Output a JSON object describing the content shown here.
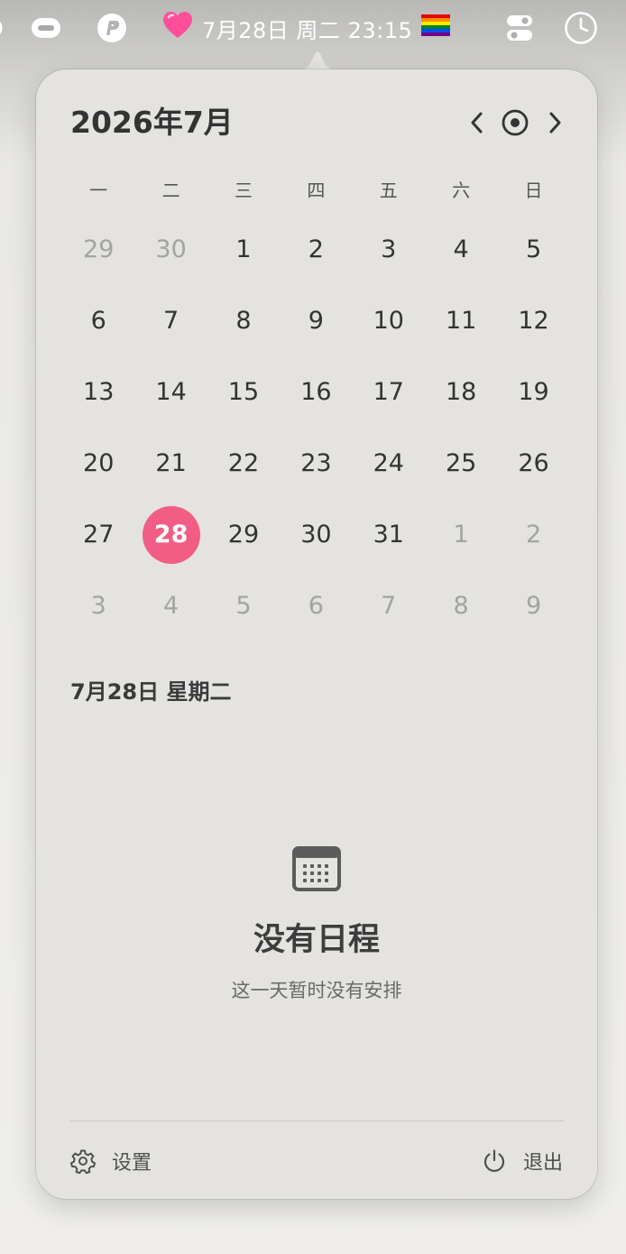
{
  "menubar": {
    "date_text": "7月28日 周二 23:15",
    "icons": [
      "toggle-icon",
      "paypal-icon",
      "heart-emoji-icon",
      "rainbow-flag-icon",
      "control-center-icon",
      "clock-icon"
    ],
    "heart_color": "#ff4f9a"
  },
  "calendar": {
    "title": "2026年7月",
    "prev_icon": "chevron-left-icon",
    "today_icon": "today-target-icon",
    "next_icon": "chevron-right-icon",
    "weekdays": [
      "一",
      "二",
      "三",
      "四",
      "五",
      "六",
      "日"
    ],
    "weeks": [
      [
        "29",
        "30",
        "1",
        "2",
        "3",
        "4",
        "5"
      ],
      [
        "6",
        "7",
        "8",
        "9",
        "10",
        "11",
        "12"
      ],
      [
        "13",
        "14",
        "15",
        "16",
        "17",
        "18",
        "19"
      ],
      [
        "20",
        "21",
        "22",
        "23",
        "24",
        "25",
        "26"
      ],
      [
        "27",
        "28",
        "29",
        "30",
        "31",
        "1",
        "2"
      ],
      [
        "3",
        "4",
        "5",
        "6",
        "7",
        "8",
        "9"
      ]
    ],
    "today": "28",
    "today_color": "#f25d85"
  },
  "agenda": {
    "selected_date": "7月28日 星期二",
    "empty_icon": "calendar-icon",
    "empty_title": "没有日程",
    "empty_subtitle": "这一天暂时没有安排"
  },
  "footer": {
    "settings_label": "设置",
    "settings_icon": "gear-icon",
    "quit_label": "退出",
    "quit_icon": "power-icon"
  }
}
